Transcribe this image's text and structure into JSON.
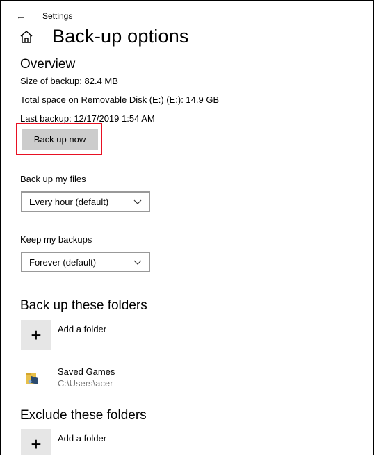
{
  "window": {
    "title": "Settings"
  },
  "page": {
    "title": "Back-up options"
  },
  "overview": {
    "heading": "Overview",
    "size": "Size of backup: 82.4 MB",
    "total_space": "Total space on Removable Disk (E:) (E:): 14.9 GB",
    "last_backup": "Last backup: 12/17/2019 1:54 AM",
    "backup_now_label": "Back up now"
  },
  "backup_files": {
    "label": "Back up my files",
    "selected": "Every hour (default)"
  },
  "keep_backups": {
    "label": "Keep my backups",
    "selected": "Forever (default)"
  },
  "backup_folders": {
    "heading": "Back up these folders",
    "add_label": "Add a folder",
    "items": [
      {
        "name": "Saved Games",
        "path": "C:\\Users\\acer"
      }
    ]
  },
  "exclude_folders": {
    "heading": "Exclude these folders",
    "add_label": "Add a folder"
  },
  "icons": {
    "back": "back-arrow-icon",
    "home": "home-icon",
    "chevron": "chevron-down-icon",
    "add": "plus-icon",
    "folder": "folder-icon"
  },
  "colors": {
    "highlight": "#e81123",
    "button_bg": "#cccccc",
    "tile_bg": "#e6e6e6",
    "path_text": "#767676"
  }
}
